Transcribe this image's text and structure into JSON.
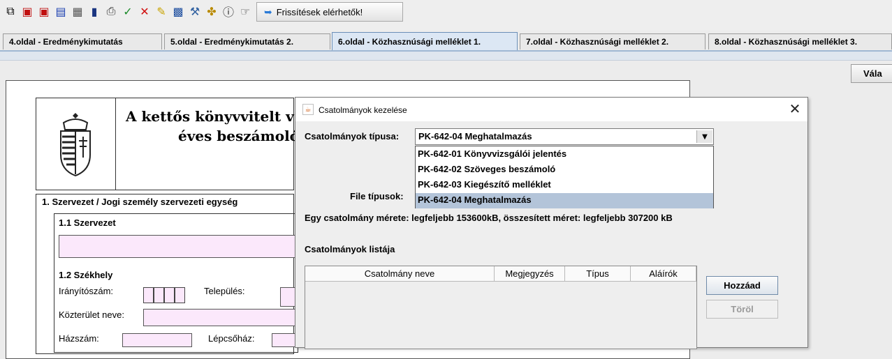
{
  "toolbar": {
    "icons": [
      "copy-icon",
      "save-icon",
      "save-as-icon",
      "export-icon",
      "print-preview-icon",
      "book-icon",
      "print-icon",
      "check-icon",
      "cancel-icon",
      "edit-icon",
      "calculator-icon",
      "tools-icon",
      "puzzle-icon",
      "info-icon",
      "pointer-icon"
    ],
    "update_label": "Frissítések elérhetők!"
  },
  "tabs": [
    {
      "label": "4.oldal - Eredménykimutatás",
      "active": false
    },
    {
      "label": "5.oldal - Eredménykimutatás 2.",
      "active": false
    },
    {
      "label": "6.oldal - Közhasznúsági melléklet 1.",
      "active": true
    },
    {
      "label": "7.oldal - Közhasznúsági melléklet 2.",
      "active": false
    },
    {
      "label": "8.oldal - Közhasznúsági melléklet 3.",
      "active": false
    }
  ],
  "right_button": "Vála",
  "form": {
    "title_line1": "A kettős könyvvitelt v",
    "title_line2": "éves beszámoló",
    "section_title": "1. Szervezet / Jogi személy szervezeti egység",
    "sub1_title": "1.1 Szervezet",
    "sub2_title": "1.2 Székhely",
    "zip_label": "Irányítószám:",
    "city_label": "Település:",
    "street_label": "Közterület neve:",
    "house_label": "Házszám:",
    "stair_label": "Lépcsőház:"
  },
  "dialog": {
    "title": "Csatolmányok kezelése",
    "type_label": "Csatolmányok típusa:",
    "selected_type": "PK-642-04 Meghatalmazás",
    "type_options": [
      "PK-642-01 Könyvvizsgálói jelentés",
      "PK-642-02 Szöveges beszámoló",
      "PK-642-03 Kiegészítő melléklet",
      "PK-642-04 Meghatalmazás"
    ],
    "file_types_label": "File típusok:",
    "size_info": "Egy csatolmány mérete: legfeljebb 153600kB, összesített méret: legfeljebb 307200 kB",
    "list_label": "Csatolmányok listája",
    "columns": [
      "Csatolmány neve",
      "Megjegyzés",
      "Típus",
      "Aláírók"
    ],
    "add_button": "Hozzáad",
    "delete_button": "Töröl"
  }
}
